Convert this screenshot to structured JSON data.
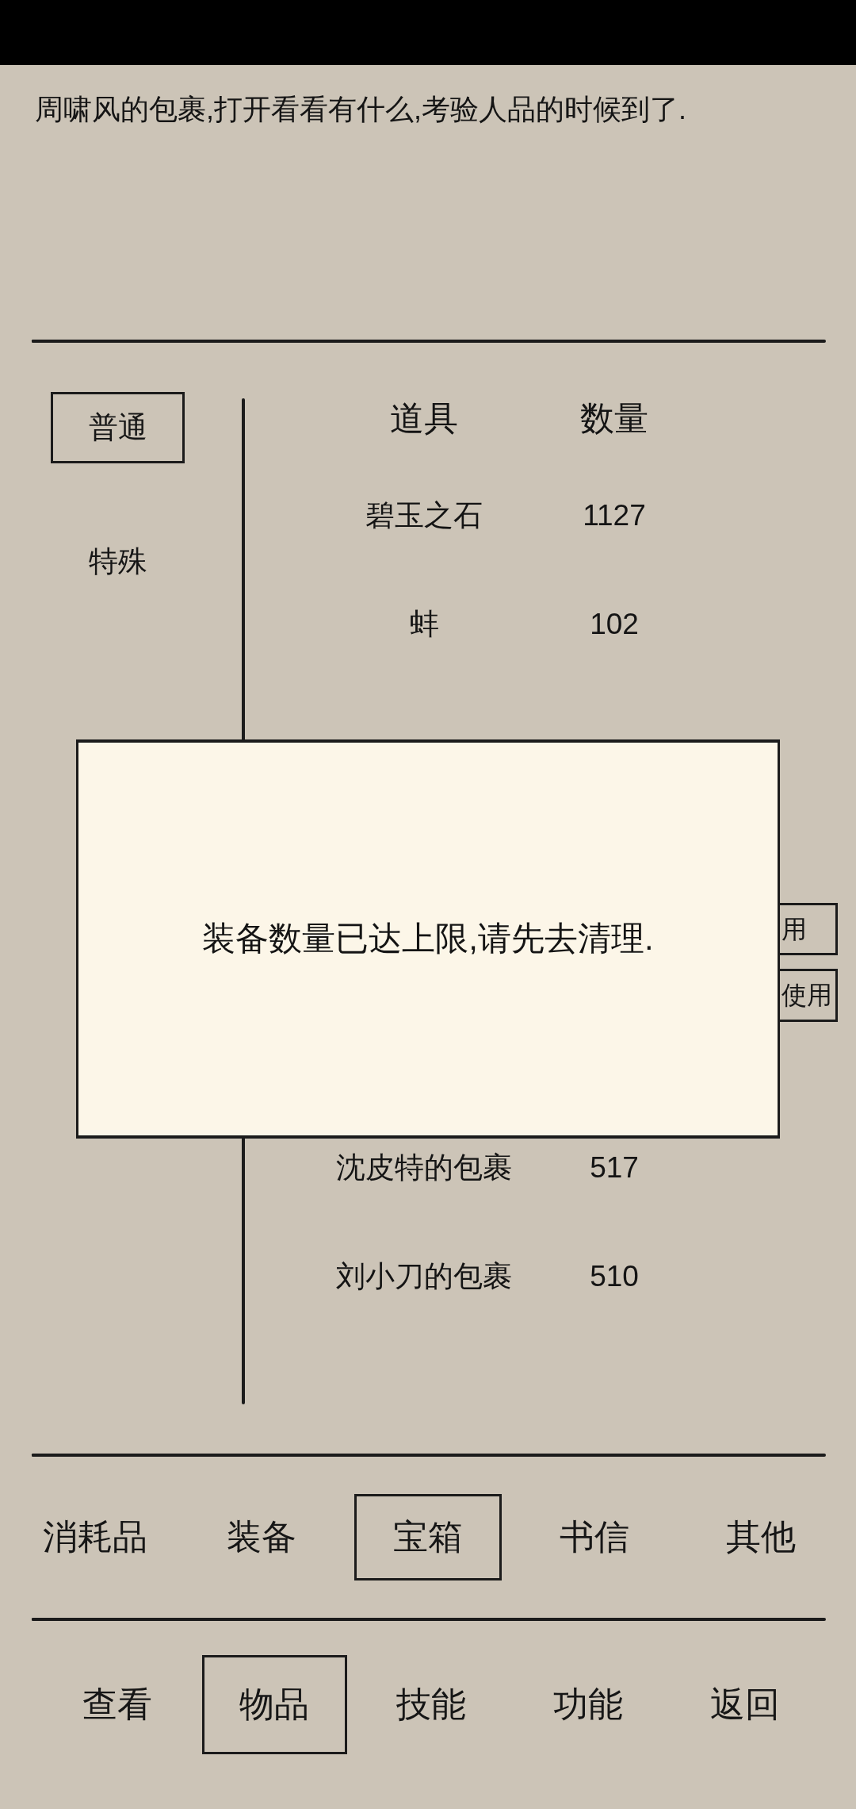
{
  "message": "周啸风的包裹,打开看看有什么,考验人品的时候到了.",
  "side_tabs": [
    {
      "label": "普通",
      "selected": true
    },
    {
      "label": "特殊",
      "selected": false
    }
  ],
  "table": {
    "columns": [
      "道具",
      "数量"
    ],
    "rows": [
      {
        "item": "碧玉之石",
        "quantity": "1127"
      },
      {
        "item": "蚌",
        "quantity": "102"
      },
      {
        "item": "沈皮特的包裹",
        "quantity": "517"
      },
      {
        "item": "刘小刀的包裹",
        "quantity": "510"
      }
    ]
  },
  "row_actions": [
    "用",
    "使用"
  ],
  "dialog": {
    "message": "装备数量已达上限,请先去清理."
  },
  "category_tabs": [
    {
      "label": "消耗品",
      "selected": false
    },
    {
      "label": "装备",
      "selected": false
    },
    {
      "label": "宝箱",
      "selected": true
    },
    {
      "label": "书信",
      "selected": false
    },
    {
      "label": "其他",
      "selected": false
    }
  ],
  "nav_tabs": [
    {
      "label": "查看",
      "selected": false
    },
    {
      "label": "物品",
      "selected": true
    },
    {
      "label": "技能",
      "selected": false
    },
    {
      "label": "功能",
      "selected": false
    },
    {
      "label": "返回",
      "selected": false
    }
  ]
}
